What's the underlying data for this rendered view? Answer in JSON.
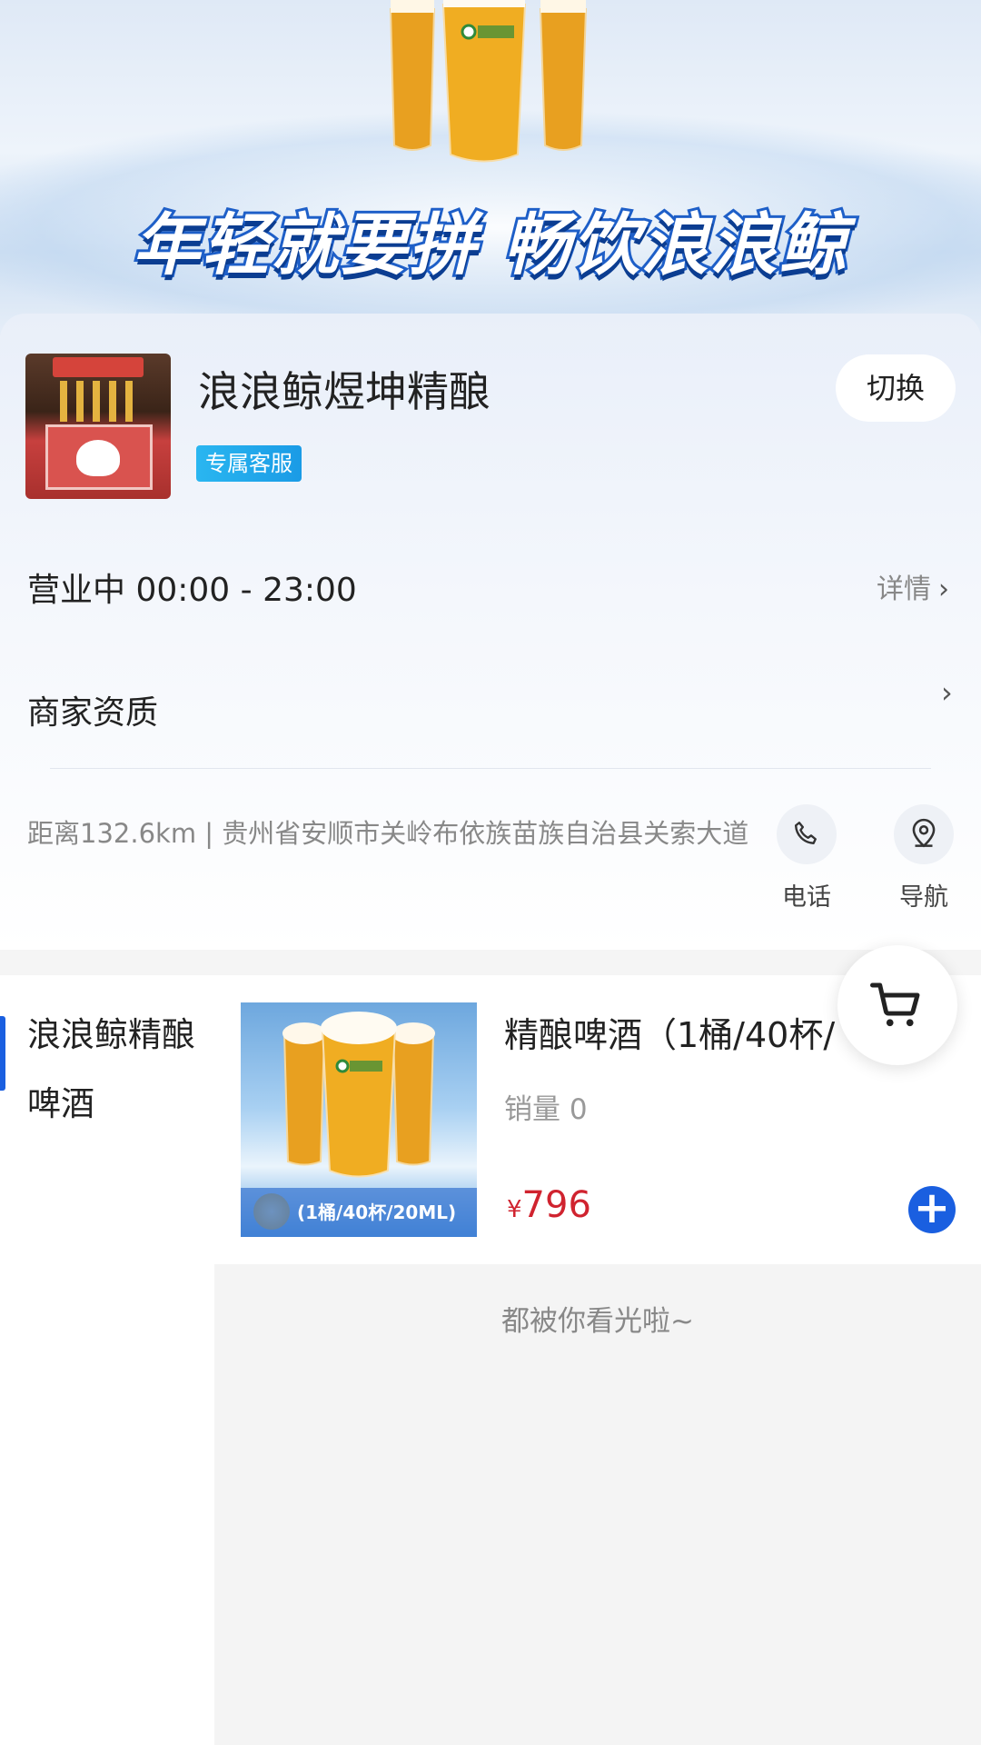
{
  "banner": {
    "slogan": "年轻就要拼 畅饮浪浪鲸",
    "glass_labels": [
      "浪浪鲸",
      "浪浪鲸",
      "浪浪鲸"
    ]
  },
  "store": {
    "name": "浪浪鲸煜坤精酿",
    "service_tag": "专属客服",
    "switch_label": "切换",
    "hours": "营业中 00:00 - 23:00",
    "detail_label": "详情",
    "qualification_label": "商家资质",
    "address": "距离132.6km | 贵州省安顺市关岭布依族苗族自治县关索大道",
    "actions": [
      {
        "label": "电话",
        "icon": "phone-icon"
      },
      {
        "label": "导航",
        "icon": "navigation-icon"
      }
    ]
  },
  "categories": [
    {
      "name": "浪浪鲸精酿啤酒",
      "selected": true
    }
  ],
  "products": [
    {
      "title": "精酿啤酒（1桶/40杯/",
      "sales": "销量  0",
      "currency": "¥",
      "price": "796",
      "image_caption": "(1桶/40杯/20ML)"
    }
  ],
  "list_end_text": "都被你看光啦~",
  "colors": {
    "accent": "#1a5fe0",
    "price": "#d0232f",
    "tag": "#1a9be6"
  }
}
